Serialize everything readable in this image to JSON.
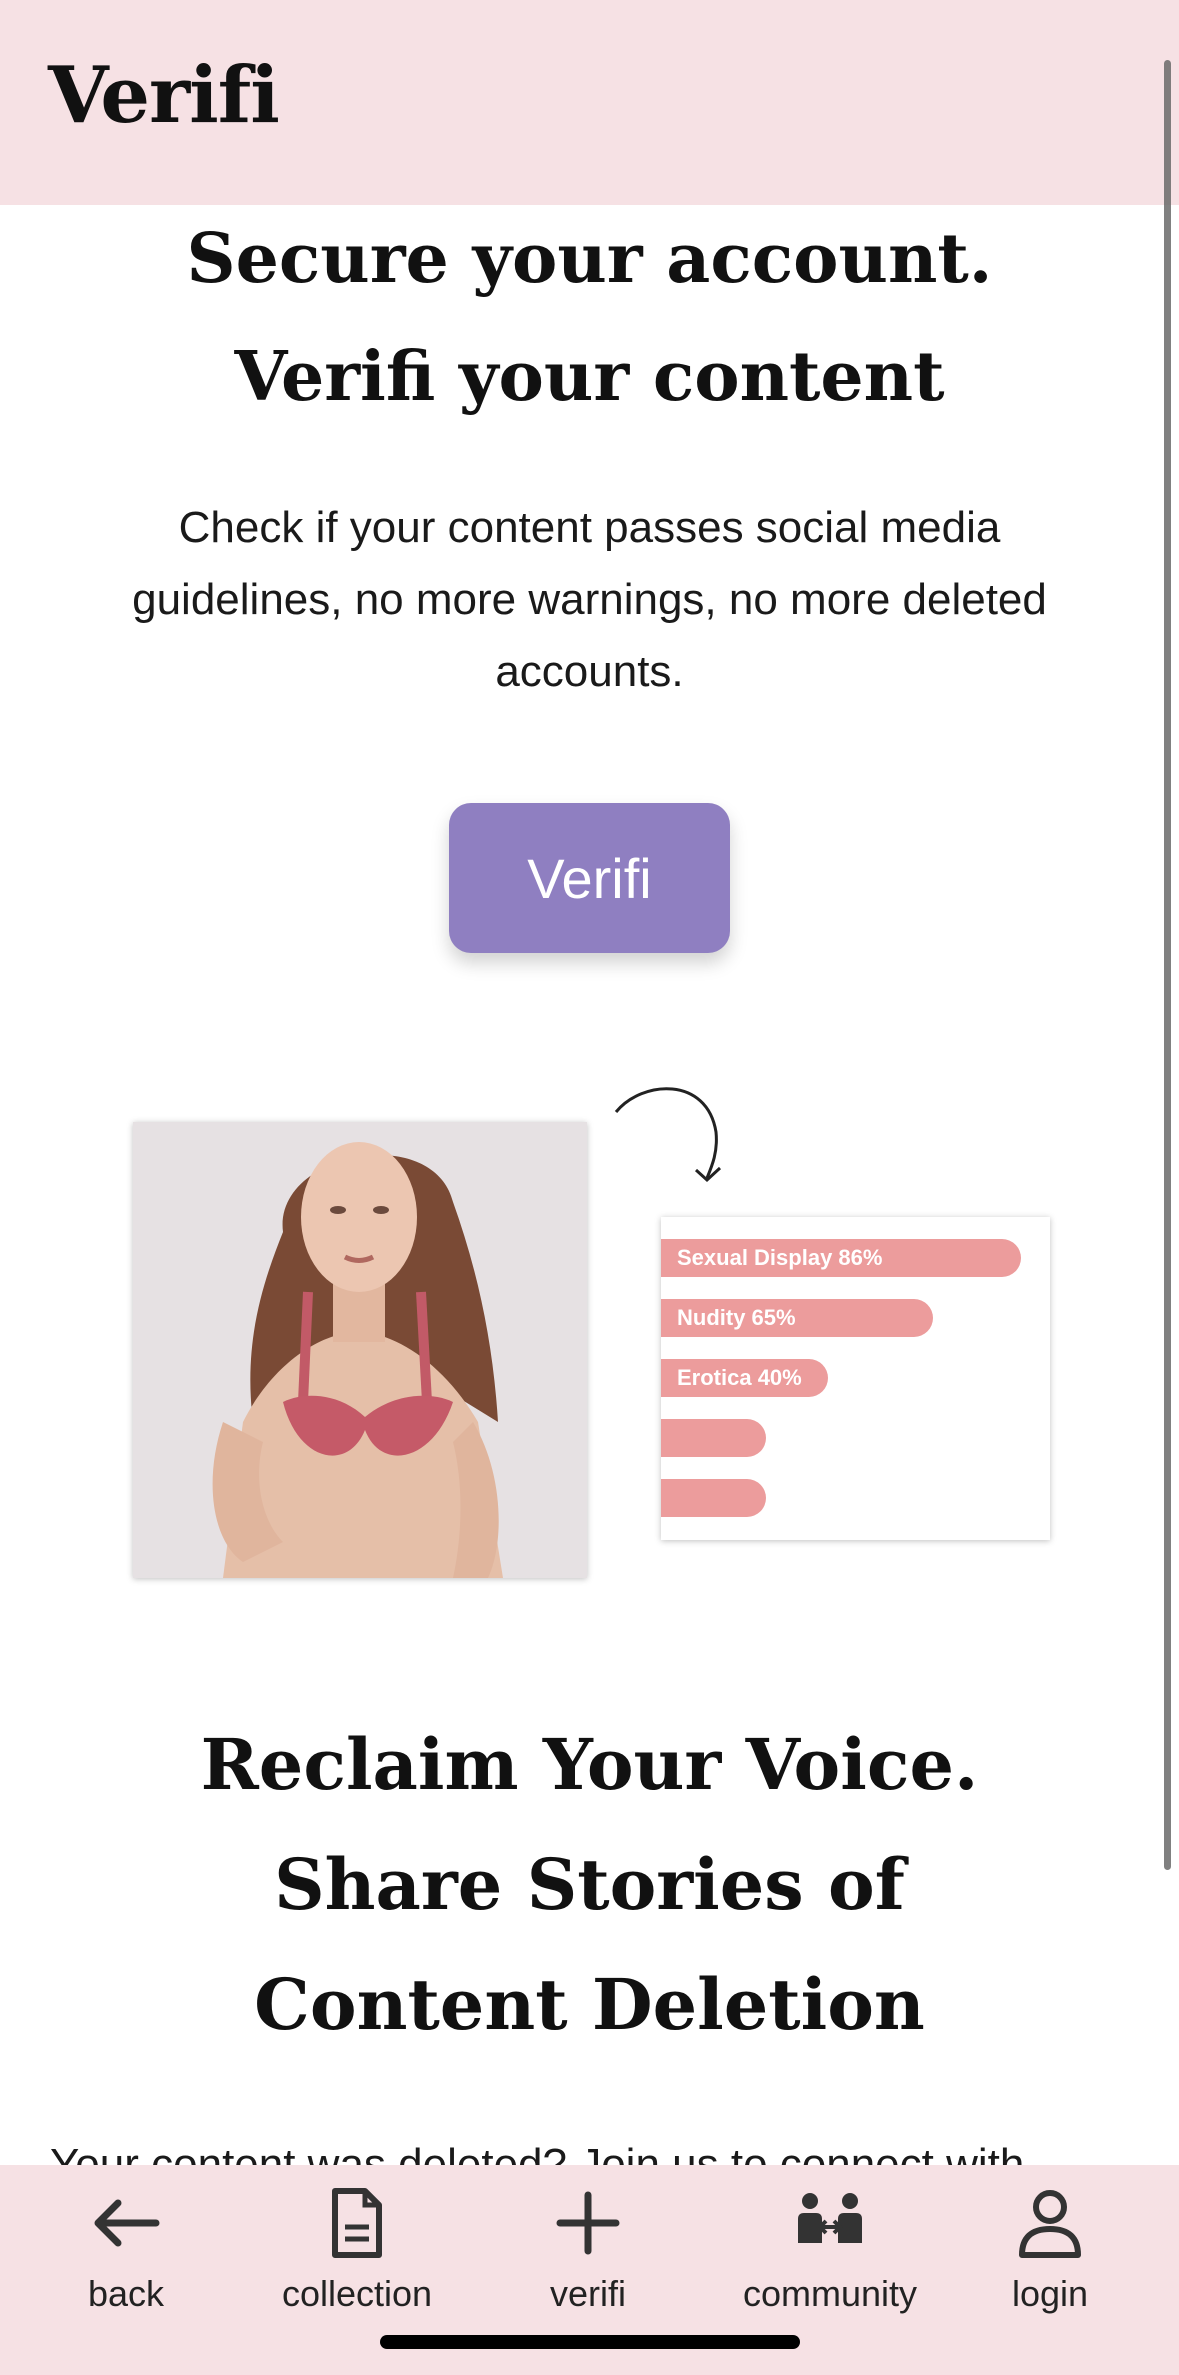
{
  "header": {
    "logo": "Verifi"
  },
  "hero": {
    "title_line1": "Secure your account.",
    "title_line2": "Verifi your content",
    "subtitle": "Check if your content passes social media guidelines, no more warnings, no more deleted accounts.",
    "button_label": "Verifi"
  },
  "illustration": {
    "bars": [
      {
        "label": "Sexual Display 86%",
        "value": 86
      },
      {
        "label": "Nudity 65%",
        "value": 65
      },
      {
        "label": "Erotica 40%",
        "value": 40
      },
      {
        "label": "",
        "value": 25
      },
      {
        "label": "",
        "value": 25
      }
    ],
    "bar_color": "#ec9c9c"
  },
  "section2": {
    "title_line1": "Reclaim Your Voice.",
    "title_line2": "Share Stories of",
    "title_line3": "Content Deletion",
    "body_partial": "Your content was deleted? Join us to connect with"
  },
  "nav": {
    "items": [
      {
        "label": "back",
        "icon": "arrow-left-icon"
      },
      {
        "label": "collection",
        "icon": "document-icon"
      },
      {
        "label": "verifi",
        "icon": "plus-icon"
      },
      {
        "label": "community",
        "icon": "people-icon"
      },
      {
        "label": "login",
        "icon": "user-icon"
      }
    ]
  },
  "colors": {
    "header_bg": "#f6e1e4",
    "button_bg": "#8f7fc1",
    "nav_bg": "#f6e1e4"
  }
}
